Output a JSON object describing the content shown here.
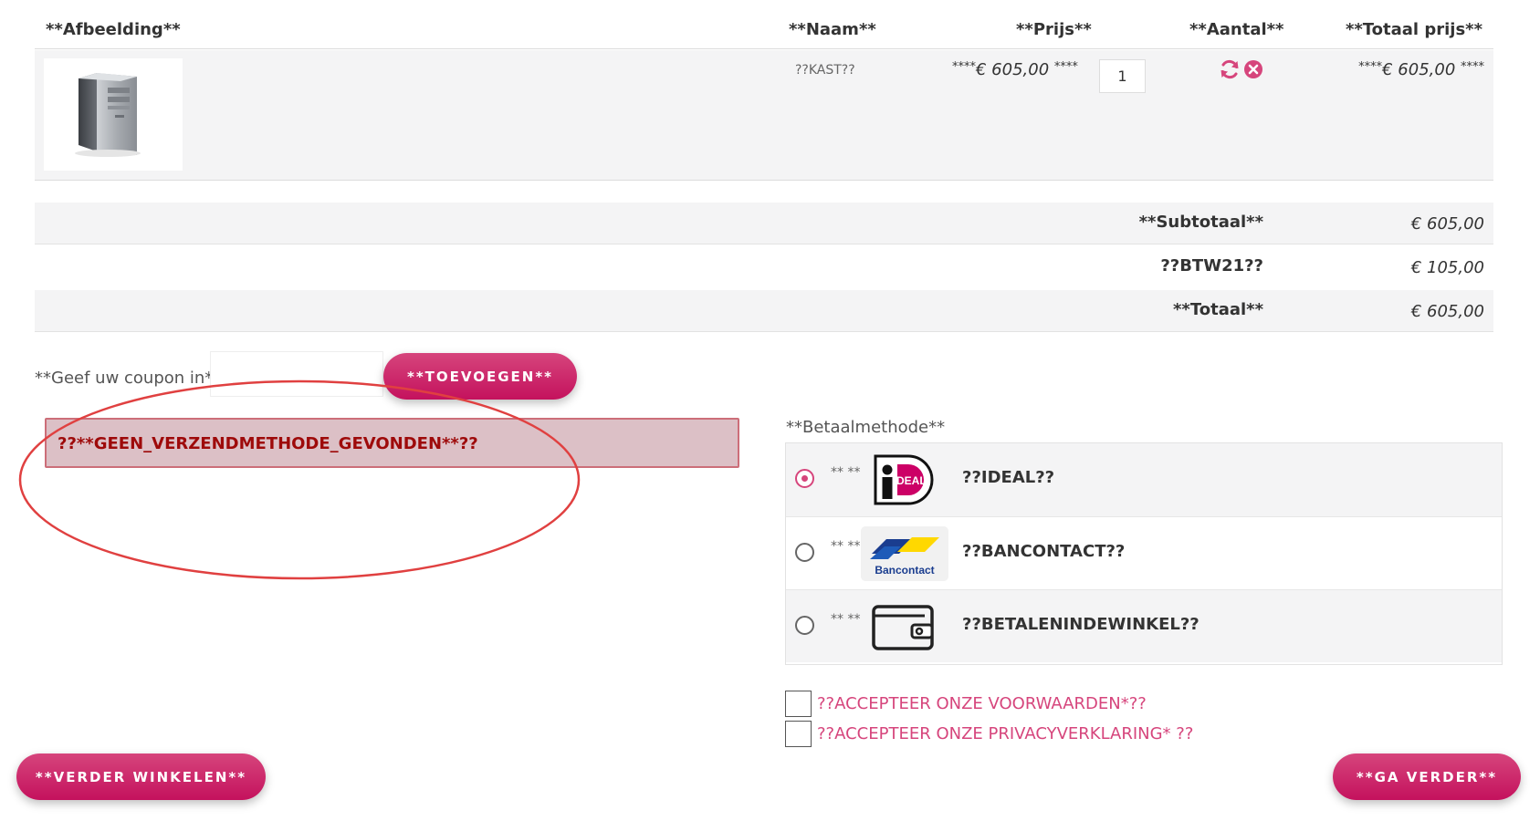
{
  "header": {
    "image": "**Afbeelding**",
    "name": "**Naam**",
    "price": "**Prijs**",
    "quantity": "**Aantal**",
    "total": "**Totaal prijs**"
  },
  "product": {
    "name": "??KAST??",
    "price_prefix": "****",
    "price": "€ 605,00",
    "price_suffix": "****",
    "quantity": "1",
    "total_prefix": "****",
    "total": "€ 605,00",
    "total_suffix": "****",
    "icons": [
      "refresh-icon",
      "remove-icon"
    ]
  },
  "totals": [
    {
      "label": "**Subtotaal**",
      "value": "€ 605,00"
    },
    {
      "label": "??BTW21??",
      "value": "€ 105,00"
    },
    {
      "label": "**Totaal**",
      "value": "€ 605,00"
    }
  ],
  "coupon": {
    "label": "**Geef uw coupon in**",
    "value": "",
    "button": "**TOEVOEGEN**"
  },
  "alert": {
    "message": "??**GEEN_VERZENDMETHODE_GEVONDEN**??"
  },
  "payment": {
    "label": "**Betaalmethode**",
    "methods": [
      {
        "dots": "** **",
        "name": "??IDEAL??",
        "logo": "ideal-logo",
        "selected": true
      },
      {
        "dots": "** **",
        "name": "??BANCONTACT??",
        "logo": "bancontact-logo",
        "logo_text": "Bancontact",
        "selected": false
      },
      {
        "dots": "** **",
        "name": "??BETALENINDEWINKEL??",
        "logo": "wallet-icon",
        "selected": false
      }
    ]
  },
  "terms": {
    "accept_terms": "??ACCEPTEER ONZE VOORWAARDEN*??",
    "accept_privacy": "??ACCEPTEER ONZE PRIVACYVERKLARING* ??"
  },
  "buttons": {
    "continue_shopping": "**VERDER WINKELEN**",
    "proceed": "**GA VERDER**"
  },
  "colors": {
    "accent": "#c4125d",
    "accent_light": "#d6457c",
    "alert_bg": "#dcc0c6",
    "alert_text": "#9e0a0a",
    "annotation": "#e04040",
    "row_shade": "#f4f4f5"
  }
}
